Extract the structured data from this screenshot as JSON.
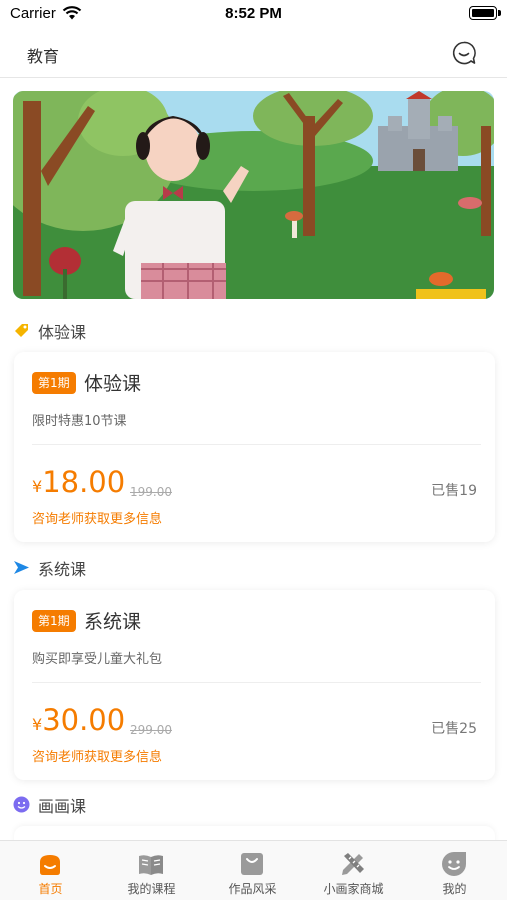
{
  "status_bar": {
    "carrier": "Carrier",
    "time": "8:52 PM"
  },
  "nav": {
    "title": "教育",
    "right_icon": "chat-bubble-icon"
  },
  "banner": {
    "corner_text": ""
  },
  "sections": [
    {
      "label": "体验课",
      "icon": "tag-icon",
      "icon_color": "#f5b400"
    },
    {
      "label": "系统课",
      "icon": "arrow-right-icon",
      "icon_color": "#1e88e5"
    },
    {
      "label": "画画课",
      "icon": "smiley-icon",
      "icon_color": "#7c6cf0"
    }
  ],
  "cards": [
    {
      "badge": "第1期",
      "title": "体验课",
      "subtitle": "限时特惠10节课",
      "currency": "¥",
      "price": "18.00",
      "old_price": "199.00",
      "sold": "已售19",
      "consult": "咨询老师获取更多信息"
    },
    {
      "badge": "第1期",
      "title": "系统课",
      "subtitle": "购买即享受儿童大礼包",
      "currency": "¥",
      "price": "30.00",
      "old_price": "299.00",
      "sold": "已售25",
      "consult": "咨询老师获取更多信息"
    }
  ],
  "tabs": [
    {
      "label": "首页",
      "icon": "home-icon",
      "active": true
    },
    {
      "label": "我的课程",
      "icon": "book-icon",
      "active": false
    },
    {
      "label": "作品风采",
      "icon": "bag-icon",
      "active": false
    },
    {
      "label": "小画家商城",
      "icon": "pencil-ruler-icon",
      "active": false
    },
    {
      "label": "我的",
      "icon": "profile-face-icon",
      "active": false
    }
  ],
  "colors": {
    "accent": "#f57c00",
    "tab_inactive": "#9a9a9a"
  }
}
